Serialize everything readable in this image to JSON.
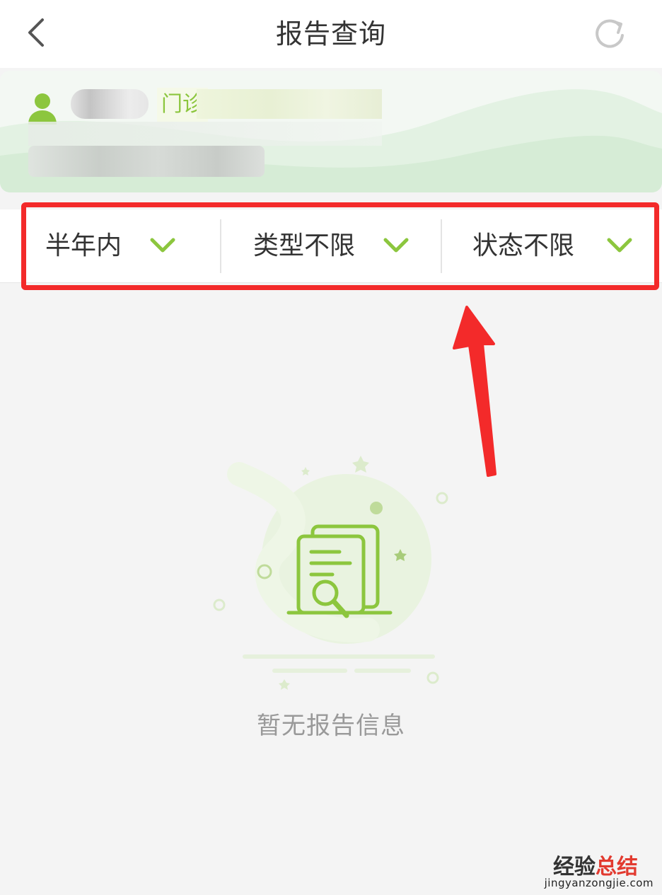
{
  "header": {
    "title": "报告查询",
    "back_icon": "chevron-left-icon",
    "refresh_icon": "refresh-icon"
  },
  "patient_card": {
    "clinic_label": "门诊",
    "avatar_icon": "user-icon",
    "accent_color": "#8cc63e"
  },
  "filters": [
    {
      "label": "半年内",
      "icon": "chevron-down-icon"
    },
    {
      "label": "类型不限",
      "icon": "chevron-down-icon"
    },
    {
      "label": "状态不限",
      "icon": "chevron-down-icon"
    }
  ],
  "annotation": {
    "highlight_color": "#f32a2a"
  },
  "empty_state": {
    "message": "暂无报告信息",
    "icon": "document-search-icon"
  },
  "watermark": {
    "part1": "经验",
    "part2": "总结",
    "url": "jingyanzongjie.com"
  }
}
